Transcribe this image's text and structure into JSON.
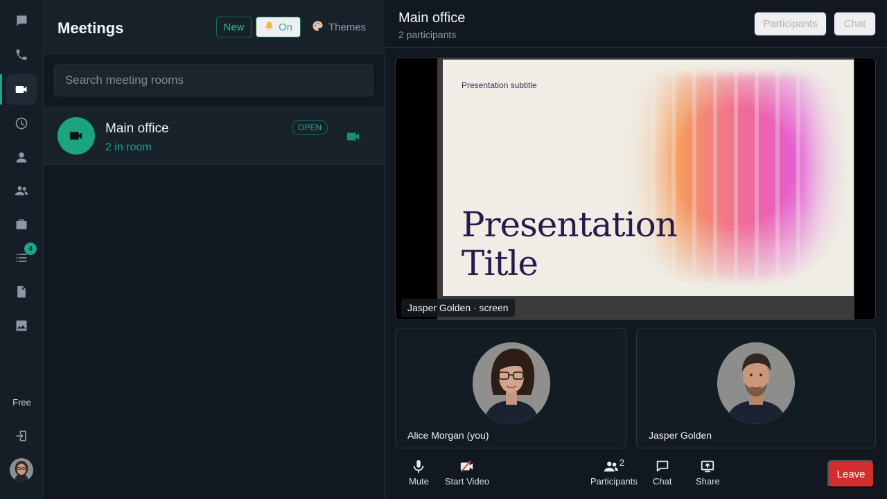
{
  "sidebar": {
    "items": [
      {
        "icon": "chat-bubble-icon"
      },
      {
        "icon": "phone-icon"
      },
      {
        "icon": "video-camera-icon",
        "active": true
      },
      {
        "icon": "clock-icon"
      },
      {
        "icon": "person-icon"
      },
      {
        "icon": "people-icon"
      },
      {
        "icon": "briefcase-icon"
      },
      {
        "icon": "list-icon",
        "badge": "4"
      },
      {
        "icon": "document-icon"
      },
      {
        "icon": "image-icon"
      }
    ],
    "plan_label": "Free",
    "logout_icon": "logout-icon"
  },
  "meetings": {
    "title": "Meetings",
    "new_label": "New",
    "notifications_label": "On",
    "themes_label": "Themes",
    "search_placeholder": "Search meeting rooms",
    "rooms": [
      {
        "name": "Main office",
        "count": "2 in room",
        "status": "OPEN"
      }
    ]
  },
  "conference": {
    "title": "Main office",
    "subtitle": "2 participants",
    "participants_button": "Participants",
    "chat_button": "Chat",
    "screen_share": {
      "label": "Jasper Golden · screen",
      "slide_subtitle": "Presentation subtitle",
      "slide_title_line1": "Presentation",
      "slide_title_line2": "Title"
    },
    "tiles": [
      {
        "name": "Alice Morgan (you)"
      },
      {
        "name": "Jasper Golden"
      }
    ]
  },
  "toolbar": {
    "mute": "Mute",
    "start_video": "Start Video",
    "participants": "Participants",
    "participants_count": "2",
    "chat": "Chat",
    "share": "Share",
    "leave": "Leave"
  },
  "colors": {
    "accent": "#1fa58b",
    "danger": "#d12f2f",
    "background": "#111820"
  }
}
